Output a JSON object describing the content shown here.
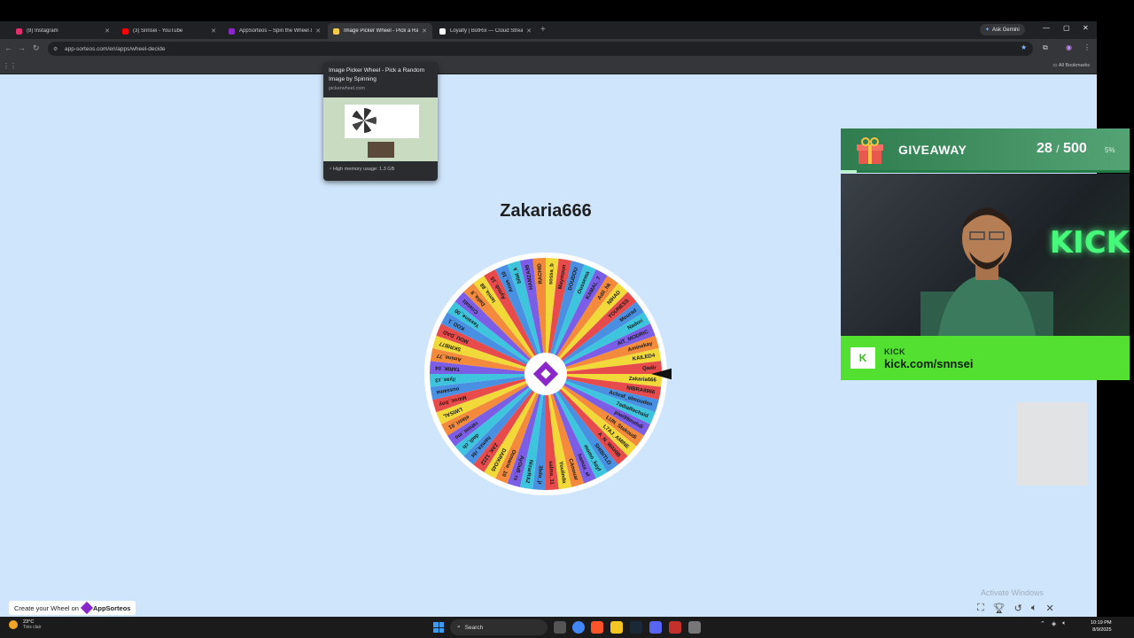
{
  "browser": {
    "tabs": [
      {
        "label": "(8) Instagram",
        "color": "#e1306c"
      },
      {
        "label": "(3) Snnsei - YouTube",
        "color": "#ff0000"
      },
      {
        "label": "AppSorteos – Spin the Wheel &",
        "color": "#8b26c9"
      },
      {
        "label": "Image Picker Wheel - Pick a Ra",
        "color": "#f7c948"
      },
      {
        "label": "Loyalty | BotRix — Cloud Stream",
        "color": "#ffffff"
      }
    ],
    "new_tab": "+",
    "ask_gemini": "Ask Gemini",
    "url": "app-sorteos.com/en/apps/wheel-decide",
    "all_bookmarks": "All Bookmarks"
  },
  "tooltip": {
    "title": "Image Picker Wheel - Pick a Random Image by Spinning",
    "domain": "pickerwheel.com",
    "memory": "High memory usage: 1.3 GB"
  },
  "main": {
    "winner": "Zakaria666",
    "wheel_names": [
      "Zakaria666",
      "NIBRA9966",
      "Achraf_elmouden",
      "7adiaRechaid",
      "piwi99mehdi",
      "LUN_Stakoudi",
      "L7AJ_AMINE",
      "A_N_WAHIB",
      "SHIBITLO",
      "momo_kayf",
      "hamza_el",
      "CAnouar",
      "Youlinda",
      "salma_11",
      "3bdo_jr",
      "NizarRA2",
      "AyOuB_rs",
      "Otmane_10",
      "DARKO45",
      "ZAK_1212",
      "hamza_rbt",
      "dadi_ch",
      "rahimi_mo",
      "elasri_01",
      "LWISAL",
      "M4roc_boy",
      "oussama",
      "ilyas_z3",
      "TARIK_04",
      "Amine_77",
      "SKRIB77",
      "MOU_DAD",
      "KOD_1",
      "Yassine_00",
      "Cristalz",
      "Dalia_9",
      "lamia_88",
      "Ayoub_15",
      "Anas_10",
      "bilal_k",
      "HAMZA99",
      "RACHID",
      "sossa_b",
      "Maymoun",
      "DOUDOU",
      "Oussema",
      "KAMAL_7",
      "Adil_hk",
      "NIHAD",
      "YOUNESS",
      "Mourad",
      "Nadori",
      "AIT_MODRIC",
      "Aminekay",
      "KAILED4",
      "Qadir"
    ],
    "create_label": "Create your Wheel on",
    "create_brand": "AppSorteos"
  },
  "giveaway": {
    "title": "GIVEAWAY",
    "current": "28",
    "separator": "/",
    "total": "500",
    "percent": "5%",
    "progress": 0.056,
    "platform": "KICK",
    "url": "kick.com/snnsei",
    "neon": "KICK"
  },
  "os": {
    "activate": "Activate Windows",
    "search": "Search",
    "temp": "23°C",
    "condition": "Très clair",
    "time": "10:19 PM",
    "date": "8/9/2025"
  },
  "colors": {
    "wheel_segments": [
      "#f1d93a",
      "#e84b4b",
      "#4a90e2",
      "#3ec4dd",
      "#7b5de6",
      "#f38a3c"
    ],
    "accent": "#8b26c9",
    "kick_green": "#53e030"
  }
}
